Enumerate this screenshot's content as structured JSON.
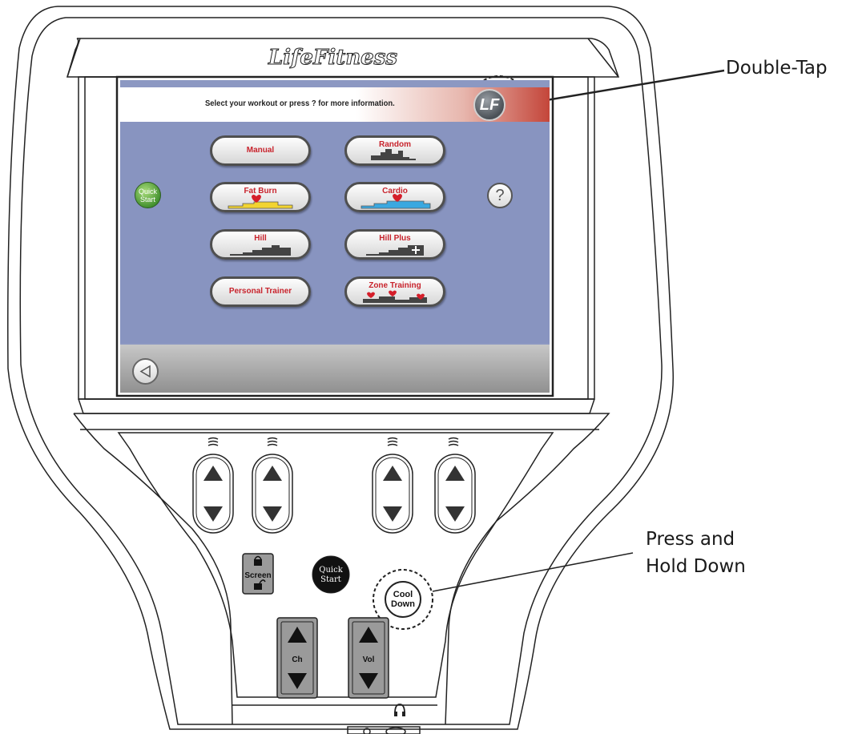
{
  "brand": "LifeFitness",
  "screen": {
    "prompt": "Select your workout or press ? for more information.",
    "logo_text": "LF",
    "quick_start_label": "Quick Start",
    "help_label": "?",
    "workouts": [
      {
        "label": "Manual"
      },
      {
        "label": "Random"
      },
      {
        "label": "Fat Burn"
      },
      {
        "label": "Cardio"
      },
      {
        "label": "Hill"
      },
      {
        "label": "Hill Plus"
      },
      {
        "label": "Personal Trainer"
      },
      {
        "label": "Zone Training"
      }
    ]
  },
  "keypad": {
    "screen_lock_label": "Screen",
    "quick_start_line1": "Quick",
    "quick_start_line2": "Start",
    "cool_down_line1": "Cool",
    "cool_down_line2": "Down",
    "channel_label": "Ch",
    "volume_label": "Vol"
  },
  "callouts": {
    "double_tap": "Double-Tap",
    "press_hold_line1": "Press and",
    "press_hold_line2": "Hold Down"
  },
  "colors": {
    "screen_background": "#8894c0",
    "workout_label": "#c8232c",
    "header_red": "#c4463a",
    "quick_start_green": "#4f9e37"
  }
}
